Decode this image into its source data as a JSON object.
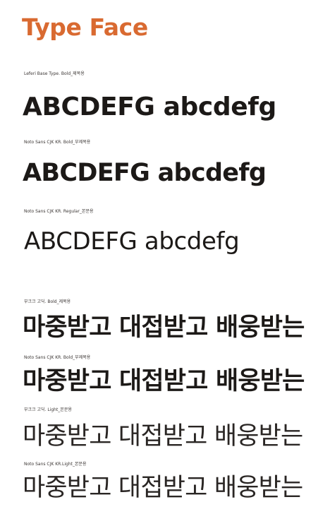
{
  "title": "Type Face",
  "colors": {
    "title": "#d96a31",
    "text": "#1c1917"
  },
  "specimens": [
    {
      "caption": "Leferi Base Type. Bold_제목용",
      "sample": "ABCDEFG abcdefg"
    },
    {
      "caption": "Noto Sans CJK KR. Bold_부제목용",
      "sample": "ABCDEFG abcdefg"
    },
    {
      "caption": "Noto Sans CJK KR. Regular_본문용",
      "sample": "ABCDEFG abcdefg"
    },
    {
      "caption": "부크크 고딕. Bold_제목용",
      "sample": "마중받고 대접받고 배웅받는"
    },
    {
      "caption": "Noto Sans CJK KR. Bold_부제목용",
      "sample": "마중받고 대접받고 배웅받는"
    },
    {
      "caption": "부크크 고딕. Light_본문용",
      "sample": "마중받고 대접받고 배웅받는"
    },
    {
      "caption": "Noto Sans CJK KR.Light_본문용",
      "sample": "마중받고 대접받고 배웅받는"
    }
  ]
}
